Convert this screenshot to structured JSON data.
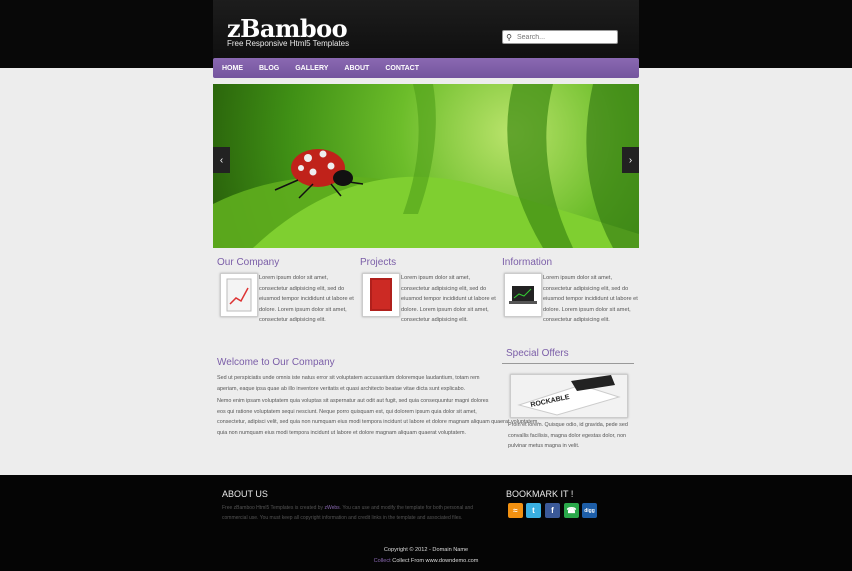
{
  "header": {
    "logo": "zBamboo",
    "tagline": "Free Responsive Html5 Templates",
    "search_placeholder": "Search..."
  },
  "nav": [
    "HOME",
    "BLOG",
    "GALLERY",
    "ABOUT",
    "CONTACT"
  ],
  "slider": {
    "prev": "‹",
    "next": "›"
  },
  "columns": [
    {
      "title": "Our Company",
      "lines": [
        "Lorem ipsum dolor sit amet,",
        "consectetur adipisicing elit, sed do",
        "eiusmod tempor incididunt ut labore et",
        "dolore. Lorem ipsum dolor sit amet,",
        "consectetur adipisicing elit."
      ]
    },
    {
      "title": "Projects",
      "lines": [
        "Lorem ipsum dolor sit amet,",
        "consectetur adipisicing elit, sed do",
        "eiusmod tempor incididunt ut labore et",
        "dolore. Lorem ipsum dolor sit amet,",
        "consectetur adipisicing elit."
      ]
    },
    {
      "title": "Information",
      "lines": [
        "Lorem ipsum dolor sit amet,",
        "consectetur adipisicing elit, sed do",
        "eiusmod tempor incididunt ut labore et",
        "dolore. Lorem ipsum dolor sit amet,",
        "consectetur adipisicing elit."
      ]
    }
  ],
  "welcome": {
    "title": "Welcome to Our Company",
    "p1": [
      "Sed ut perspiciatis unde omnis iste natus error sit voluptatem accusantium doloremque laudantium, totam rem",
      "aperiam, eaque ipsa quae ab illo inventore veritatis et quasi architecto beatae vitae dicta sunt explicabo."
    ],
    "p2": [
      "Nemo enim ipsam voluptatem quia voluptas sit aspernatur aut odit aut fugit, sed quia consequuntur magni dolores",
      "eos qui ratione voluptatem sequi nesciunt. Neque porro quisquam est, qui dolorem ipsum quia dolor sit amet,",
      "consectetur, adipisci velit, sed quia non numquam eius modi tempora incidunt ut labore et dolore magnam aliquam quaerat voluptatem.",
      "quia non numquam eius modi tempora incidunt ut labore et dolore magnam aliquam quaerat voluptatem."
    ]
  },
  "offers": {
    "title": "Special Offers",
    "image_label": "ROCKABLE",
    "lines": [
      "Proin et lorem. Quisque odio, id gravida, pede sed",
      "convallis facilisis, magna dolor egestas dolor, non",
      "pulvinar metus magna in velit."
    ]
  },
  "footer": {
    "about_title": "ABOUT US",
    "about_line1_a": "Free zBamboo Html5 Templates is created by",
    "about_line1_link": "zWebs",
    "about_line1_b": ". You can use and modify the template for both personal and",
    "about_line2": "commercial use. You must keep all copyright information and credit links in the template and associated files.",
    "bookmark_title": "BOOKMARK IT !",
    "social": [
      "rss-icon",
      "twitter-icon",
      "facebook-icon",
      "share-icon",
      "digg-icon"
    ],
    "copyright": "Copyright © 2012 - Domain Name",
    "collect_link": "Collect",
    "collect_text": " Collect From www.downdemo.com"
  }
}
